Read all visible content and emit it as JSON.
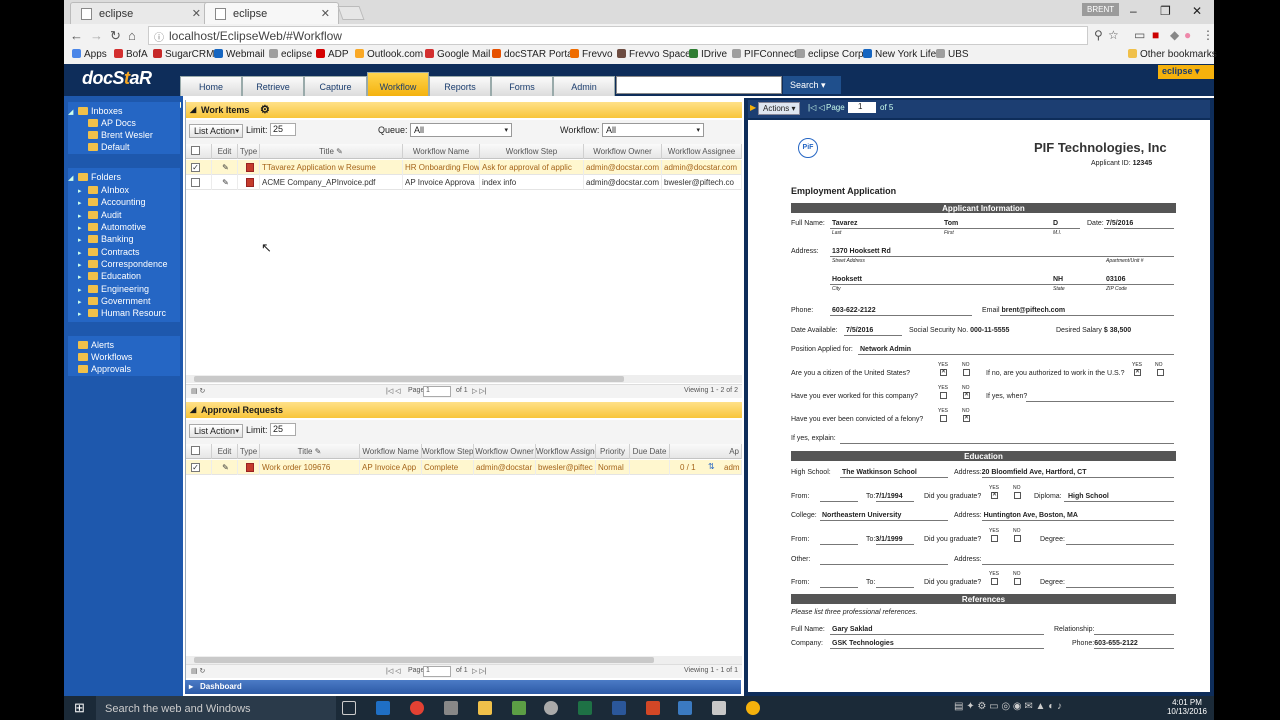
{
  "browser": {
    "tabs": [
      {
        "label": "eclipse"
      },
      {
        "label": "eclipse"
      }
    ],
    "user_badge": "BRENT",
    "url": "localhost/EclipseWeb/#Workflow",
    "bookmarks": [
      {
        "label": "Apps",
        "color": "#4a86e8"
      },
      {
        "label": "BofA",
        "color": "#d32f2f"
      },
      {
        "label": "SugarCRM",
        "color": "#c62828"
      },
      {
        "label": "Webmail",
        "color": "#1565c0"
      },
      {
        "label": "eclipse",
        "color": "#9e9e9e"
      },
      {
        "label": "ADP",
        "color": "#d50000"
      },
      {
        "label": "Outlook.com",
        "color": "#f9a825"
      },
      {
        "label": "Google Mail",
        "color": "#d32f2f"
      },
      {
        "label": "docSTAR Portal",
        "color": "#e65100"
      },
      {
        "label": "Frevvo",
        "color": "#ef6c00"
      },
      {
        "label": "Frevvo Space",
        "color": "#6d4c41"
      },
      {
        "label": "IDrive",
        "color": "#2e7d32"
      },
      {
        "label": "PIFConnect",
        "color": "#9e9e9e"
      },
      {
        "label": "eclipse Corp",
        "color": "#9e9e9e"
      },
      {
        "label": "New York Life",
        "color": "#1565c0"
      },
      {
        "label": "UBS",
        "color": "#9e9e9e"
      }
    ],
    "other_bookmarks": "Other bookmarks"
  },
  "app": {
    "logo_main": "docS",
    "logo_accent": "t",
    "logo_end": "aR",
    "nav": [
      {
        "label": "Home"
      },
      {
        "label": "Retrieve"
      },
      {
        "label": "Capture"
      },
      {
        "label": "Workflow"
      },
      {
        "label": "Reports"
      },
      {
        "label": "Forms"
      },
      {
        "label": "Admin"
      }
    ],
    "search_label": "Search",
    "eclipse_menu": "eclipse"
  },
  "sidebar": {
    "inboxes_label": "Inboxes",
    "inboxes": [
      {
        "label": "AP Docs"
      },
      {
        "label": "Brent Wesler"
      },
      {
        "label": "Default"
      }
    ],
    "folders_label": "Folders",
    "folders": [
      {
        "label": "AInbox"
      },
      {
        "label": "Accounting"
      },
      {
        "label": "Audit"
      },
      {
        "label": "Automotive"
      },
      {
        "label": "Banking"
      },
      {
        "label": "Contracts"
      },
      {
        "label": "Correspondence"
      },
      {
        "label": "Education"
      },
      {
        "label": "Engineering"
      },
      {
        "label": "Government"
      },
      {
        "label": "Human Resourc"
      }
    ],
    "extras": [
      {
        "label": "Alerts"
      },
      {
        "label": "Workflows"
      },
      {
        "label": "Approvals"
      }
    ]
  },
  "work_items": {
    "title": "Work Items",
    "list_action": "List Action",
    "limit_label": "Limit:",
    "limit_value": "25",
    "queue_label": "Queue:",
    "queue_value": "All",
    "workflow_label": "Workflow:",
    "workflow_value": "All",
    "columns": [
      "Edit",
      "Type",
      "Title",
      "Workflow Name",
      "Workflow Step",
      "Workflow Owner",
      "Workflow Assignee"
    ],
    "rows": [
      {
        "title": "TTavarez Application w Resume",
        "workflow": "HR Onboarding Flow",
        "step": "Ask for approval of applic",
        "owner": "admin@docstar.com",
        "assignee": "admin@docstar.com"
      },
      {
        "title": "ACME Company_APInvoice.pdf",
        "workflow": "AP Invoice Approva",
        "step": "index info",
        "owner": "admin@docstar.com",
        "assignee": "bwesler@piftech.co"
      }
    ],
    "page_label": "Page",
    "page_value": "1",
    "of_label": "of 1",
    "viewing": "Viewing 1 - 2 of 2"
  },
  "approvals": {
    "title": "Approval Requests",
    "list_action": "List Action",
    "limit_label": "Limit:",
    "limit_value": "25",
    "columns": [
      "Edit",
      "Type",
      "Title",
      "Workflow Name",
      "Workflow Step",
      "Workflow Owner",
      "Workflow Assignee",
      "Priority",
      "Due Date",
      "Ap"
    ],
    "rows": [
      {
        "title": "Work order 109676",
        "workflow": "AP Invoice App",
        "step": "Complete",
        "owner": "admin@docstar",
        "assignee": "bwesler@piftec",
        "priority": "Normal",
        "due": "",
        "count": "0 / 1",
        "ap": "adm"
      }
    ],
    "page_label": "Page",
    "page_value": "1",
    "of_label": "of 1",
    "viewing": "Viewing 1 - 1 of 1"
  },
  "dashboard_label": "Dashboard",
  "viewer": {
    "actions": "Actions",
    "page_label": "Page",
    "page_value": "1",
    "of_label": "of 5"
  },
  "doc": {
    "company": "PIF Technologies, Inc",
    "logo": "PiF",
    "applicant_id_label": "Applicant ID:",
    "applicant_id": "12345",
    "heading": "Employment Application",
    "sec_applicant": "Applicant Information",
    "full_name_label": "Full Name:",
    "last": "Tavarez",
    "first": "Tom",
    "mi": "D",
    "date_label": "Date:",
    "date": "7/5/2016",
    "last_cap": "Last",
    "first_cap": "First",
    "mi_cap": "M.I.",
    "address_label": "Address:",
    "street": "1370 Hooksett Rd",
    "street_cap": "Street Address",
    "apt_cap": "Apartment/Unit #",
    "city": "Hooksett",
    "state": "NH",
    "zip": "03106",
    "city_cap": "City",
    "state_cap": "State",
    "zip_cap": "ZIP Code",
    "phone_label": "Phone:",
    "phone": "603-622-2122",
    "email_label": "Email",
    "email": "brent@piftech.com",
    "avail_label": "Date Available:",
    "avail": "7/5/2016",
    "ssn_label": "Social Security No.",
    "ssn": "000-11-5555",
    "salary_label": "Desired Salary",
    "salary": "$ 38,500",
    "position_label": "Position Applied for:",
    "position": "Network Admin",
    "yes": "YES",
    "no": "NO",
    "q_citizen": "Are you a citizen of the United States?",
    "q_auth": "If no, are you authorized to work in the U.S.?",
    "q_worked": "Have you ever worked for this company?",
    "q_when": "If yes, when?",
    "q_felony": "Have you ever been convicted of a felony?",
    "q_explain": "If yes, explain:",
    "sec_education": "Education",
    "hs_label": "High School:",
    "hs": "The Watkinson School",
    "hs_addr_label": "Address:",
    "hs_addr": "20 Bloomfield Ave, Hartford, CT",
    "from_label": "From:",
    "to_label": "To:",
    "hs_to": "7/1/1994",
    "grad_label": "Did you graduate?",
    "diploma_label": "Diploma:",
    "diploma": "High School",
    "college_label": "College:",
    "college": "Northeastern University",
    "college_addr": "Huntington Ave, Boston, MA",
    "col_to": "3/1/1999",
    "degree_label": "Degree:",
    "other_label": "Other:",
    "sec_refs": "References",
    "refs_note": "Please list three professional references.",
    "ref_name": "Gary Saklad",
    "relationship_label": "Relationship:",
    "company_label": "Company:",
    "ref_company": "GSK Technologies",
    "ref_phone": "603-655-2122"
  },
  "taskbar": {
    "search": "Search the web and Windows",
    "time": "4:01 PM",
    "date": "10/13/2016"
  }
}
